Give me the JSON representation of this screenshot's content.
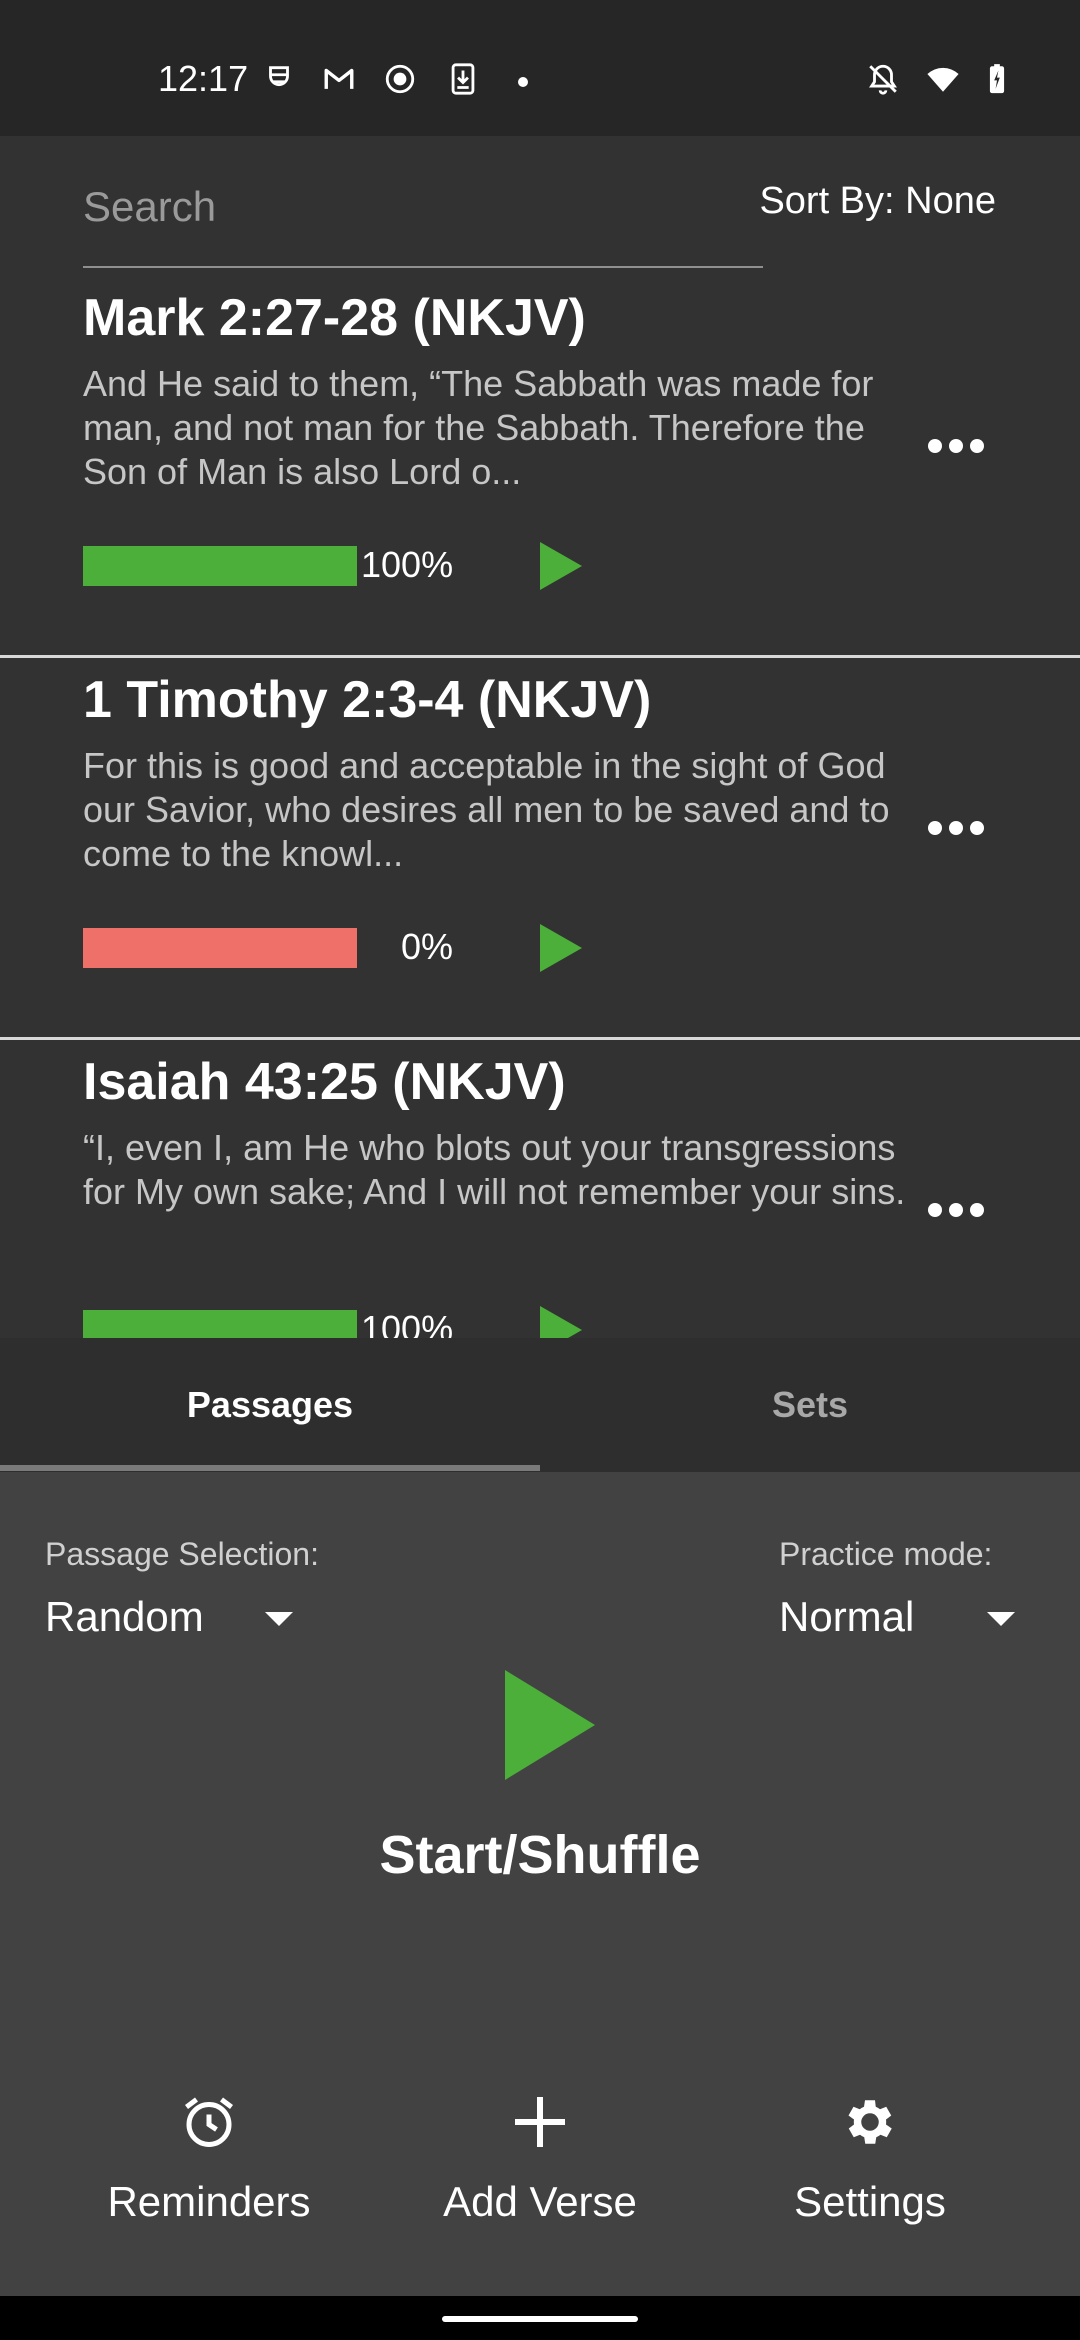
{
  "status_bar": {
    "time": "12:17",
    "icons": [
      "hat-icon",
      "gmail-icon",
      "record-icon",
      "download-icon",
      "dot",
      "notifications-off-icon",
      "wifi-icon",
      "battery-charging-icon"
    ]
  },
  "search": {
    "placeholder": "Search",
    "value": "",
    "sort_label": "Sort By: None"
  },
  "passages": [
    {
      "title": "Mark 2:27-28 (NKJV)",
      "text": "And He said to them, “The Sabbath was made for man, and not man for the Sabbath. Therefore the Son of Man is also Lord o...",
      "progress": 100,
      "progress_text": "100%",
      "color": "#4caf3a"
    },
    {
      "title": "1 Timothy 2:3-4 (NKJV)",
      "text": "For this is good and acceptable in the sight of God our Savior, who desires all men to be saved and to come to the knowl...",
      "progress": 0,
      "progress_text": "0%",
      "color": "#ef7068"
    },
    {
      "title": "Isaiah 43:25 (NKJV)",
      "text": "“I, even I, am He who blots out your transgressions for My own sake; And I will not remember your sins.",
      "progress": 100,
      "progress_text": "100%",
      "color": "#4caf3a"
    }
  ],
  "tabs": [
    {
      "label": "Passages",
      "active": true
    },
    {
      "label": "Sets",
      "active": false
    }
  ],
  "practice": {
    "selection_label": "Passage Selection:",
    "selection_value": "Random",
    "mode_label": "Practice mode:",
    "mode_value": "Normal",
    "start_label": "Start/Shuffle"
  },
  "bottom_actions": [
    {
      "label": "Reminders",
      "icon": "alarm-clock-icon"
    },
    {
      "label": "Add Verse",
      "icon": "plus-icon"
    },
    {
      "label": "Settings",
      "icon": "gear-icon"
    }
  ],
  "colors": {
    "accent_green": "#4caf3a",
    "progress_red": "#ef7068",
    "background": "#323232",
    "panel": "#424242"
  }
}
